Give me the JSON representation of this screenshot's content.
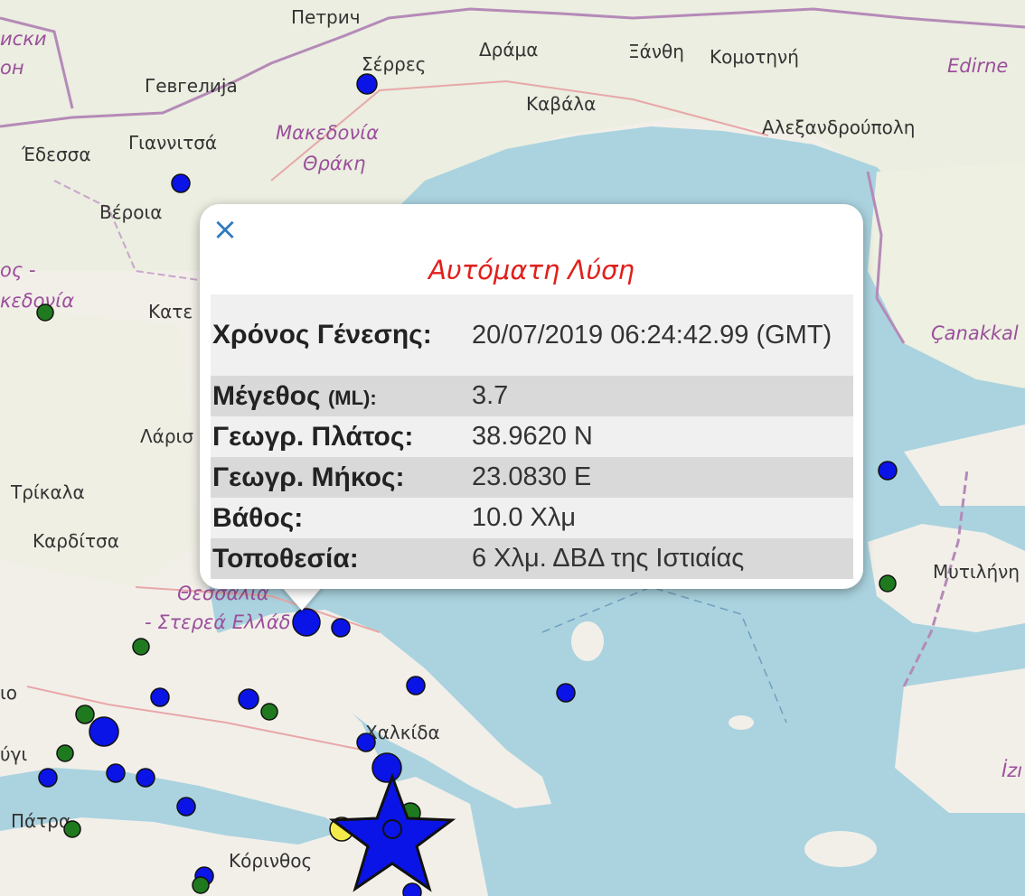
{
  "map": {
    "colors": {
      "sea": "#aad3df",
      "land": "#f2efe9",
      "border": "#b58ab8",
      "event_blue": "#0a14e6",
      "event_green": "#1f7a1f",
      "event_yellow": "#f4ea49"
    },
    "places": {
      "petrich": "Петрич",
      "serres": "Σέρρες",
      "drama": "Δράμα",
      "xanthi": "Ξάνθη",
      "komotini": "Κομοτηνή",
      "edirne": "Edirne",
      "gevgelija": "Гевгелија",
      "kavala": "Καβάλα",
      "alexandroupoli": "Αλεξανδρούπολη",
      "edessa": "Έδεσσα",
      "giannitsa": "Γιαννιτσά",
      "veroia": "Βέροια",
      "katerini": "Κατε",
      "larisa": "Λάρισ",
      "trikala": "Τρίκαλα",
      "karditsa": "Καρδίτσα",
      "chalkida": "Χαλκίδα",
      "patra": "Πάτρα",
      "korinthos": "Κόρινθος",
      "mytilini": "Μυτιλήνη",
      "canakkale": "Çanakkal",
      "izmir": "İzı",
      "west1": "иски",
      "west2": "он",
      "west3": "ύγι",
      "west4": "ιο"
    },
    "regions": {
      "makedonia_thraki_1": "Μακεδονία",
      "makedonia_thraki_2": "Θράκη",
      "makedonia_west_1": "ος -",
      "makedonia_west_2": "κεδονία",
      "thessalia": "Θεσσαλία",
      "sterea": "- Στερεά Ελλάδ"
    }
  },
  "popup": {
    "close_symbol": "×",
    "title": "Αυτόματη Λύση",
    "rows": [
      {
        "label": "Χρόνος Γένεσης:",
        "value": "20/07/2019 06:24:42.99 (GMT)"
      },
      {
        "label": "Μέγεθος",
        "label_unit": "(ML):",
        "value": "3.7"
      },
      {
        "label": "Γεωγρ. Πλάτος:",
        "value": "38.9620 N"
      },
      {
        "label": "Γεωγρ. Μήκος:",
        "value": "23.0830 E"
      },
      {
        "label": "Βάθος:",
        "value": "10.0 Χλμ"
      },
      {
        "label": "Τοποθεσία:",
        "value": "6 Χλμ. ΔΒΔ της Ιστιαίας"
      }
    ]
  }
}
